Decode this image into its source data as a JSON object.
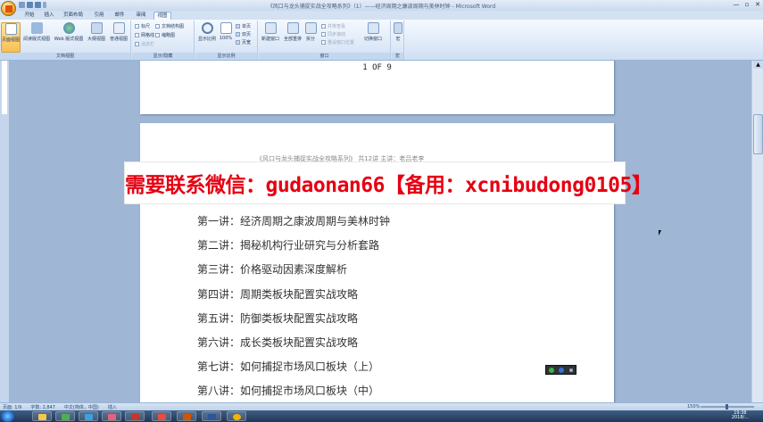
{
  "window": {
    "title": "《风口与龙头捕捉实战全攻略系列》（1）——经济周期之康波周期与美林时钟 - Microsoft Word",
    "controls": [
      "—",
      "▫",
      "✕"
    ]
  },
  "tabs": [
    {
      "label": "开始"
    },
    {
      "label": "插入"
    },
    {
      "label": "页面布局"
    },
    {
      "label": "引用"
    },
    {
      "label": "邮件"
    },
    {
      "label": "审阅"
    },
    {
      "label": "视图",
      "active": true
    }
  ],
  "ribbon": {
    "views": {
      "label": "文档视图",
      "buttons": [
        "页面视图",
        "阅读版式视图",
        "Web 版式视图",
        "大纲视图",
        "普通视图"
      ]
    },
    "show_hide": {
      "label": "显示/隐藏",
      "items": [
        {
          "label": "标尺",
          "checked": false
        },
        {
          "label": "网格线",
          "checked": false
        },
        {
          "label": "消息栏",
          "checked": false,
          "disabled": true
        },
        {
          "label": "文档结构图",
          "checked": false
        },
        {
          "label": "缩略图",
          "checked": false
        }
      ]
    },
    "zoom": {
      "label": "显示比例",
      "buttons": [
        "显示比例",
        "100%"
      ],
      "small": [
        "单页",
        "双页",
        "页宽"
      ]
    },
    "window": {
      "label": "窗口",
      "buttons": [
        "新建窗口",
        "全部重排",
        "拆分"
      ],
      "small": [
        "并排查看",
        "同步滚动",
        "重设窗口位置"
      ],
      "switch": "切换窗口"
    },
    "macro": {
      "label": "宏",
      "button": "宏"
    }
  },
  "document": {
    "page1_footer": "1 OF 9",
    "page2_header": "《风口与龙头捕捉实战全攻略系列》 共12讲 主讲：老吕老李",
    "lessons": [
      "第一讲：经济周期之康波周期与美林时钟",
      "第二讲：揭秘机构行业研究与分析套路",
      "第三讲：价格驱动因素深度解析",
      "第四讲：周期类板块配置实战攻略",
      "第五讲：防御类板块配置实战攻略",
      "第六讲：成长类板块配置实战攻略",
      "第七讲：如何捕捉市场风口板块（上）",
      "第八讲：如何捕捉市场风口板块（中）"
    ]
  },
  "banner": {
    "text": "需要联系微信：gudaonan66【备用：xcnibudong0105】",
    "color": "#e60012"
  },
  "statusbar": {
    "page": "页面: 1/9",
    "words": "字数: 2,847",
    "language": "中文(简体，中国)",
    "mode": "插入",
    "zoom": "150%"
  },
  "taskbar": {
    "time": "19:38",
    "date": "2018/..."
  },
  "colors": {
    "ribbon_bg": "#dce8f7",
    "doc_bg": "#9fb6d4",
    "taskbar": "#1f3656",
    "banner_text": "#e60012"
  }
}
